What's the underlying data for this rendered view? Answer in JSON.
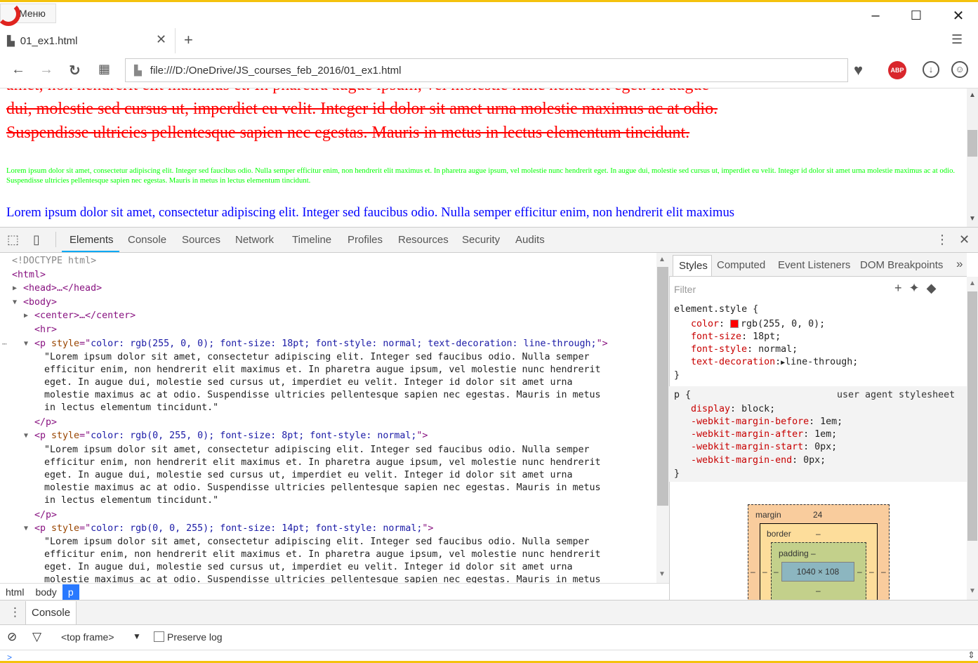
{
  "browser": {
    "menu_label": "Меню",
    "tab_title": "01_ex1.html",
    "address": "file:///D:/OneDrive/JS_courses_feb_2016/01_ex1.html",
    "adblock_label": "ABP"
  },
  "page": {
    "red_text_top": "amet, non hendrerit elit maximus et. In pharetra augue ipsum, vel molestie nunc hendrerit eget. In augue",
    "red_text_lines": [
      "dui, molestie sed cursus ut, imperdiet eu velit. Integer id dolor sit amet urna molestie maximus ac at odio.",
      "Suspendisse ultricies pellentesque sapien nec egestas. Mauris in metus in lectus elementum tincidunt."
    ],
    "green_text": "Lorem ipsum dolor sit amet, consectetur adipiscing elit. Integer sed faucibus odio. Nulla semper efficitur enim, non hendrerit elit maximus et. In pharetra augue ipsum, vel molestie nunc hendrerit eget. In augue dui, molestie sed cursus ut, imperdiet eu velit. Integer id dolor sit amet urna molestie maximus ac at odio. Suspendisse ultricies pellentesque sapien nec egestas. Mauris in metus in lectus elementum tincidunt.",
    "blue_text": "Lorem ipsum dolor sit amet, consectetur adipiscing elit. Integer sed faucibus odio. Nulla semper efficitur enim, non hendrerit elit maximus"
  },
  "devtools": {
    "tabs": [
      "Elements",
      "Console",
      "Sources",
      "Network",
      "Timeline",
      "Profiles",
      "Resources",
      "Security",
      "Audits"
    ],
    "dom": {
      "doctype": "<!DOCTYPE html>",
      "html_open": "<html>",
      "head": "<head>…</head>",
      "body_open": "<body>",
      "center": "<center>…</center>",
      "hr": "<hr>",
      "p1_style": "color: rgb(255, 0, 0); font-size: 18pt; font-style: normal; text-decoration: line-through;",
      "p2_style": "color: rgb(0, 255, 0); font-size: 8pt; font-style: normal;",
      "p3_style": "color: rgb(0, 0, 255); font-size: 14pt; font-style: normal;",
      "text_lines": [
        "\"Lorem ipsum dolor sit amet, consectetur adipiscing elit. Integer sed faucibus odio. Nulla semper",
        "efficitur enim, non hendrerit elit maximus et. In pharetra augue ipsum, vel molestie nunc hendrerit",
        "eget. In augue dui, molestie sed cursus ut, imperdiet eu velit. Integer id dolor sit amet urna",
        "molestie maximus ac at odio. Suspendisse ultricies pellentesque sapien nec egestas. Mauris in metus",
        "in lectus elementum tincidunt.\""
      ],
      "p_close": "</p>"
    },
    "breadcrumbs": [
      "html",
      "body",
      "p"
    ],
    "styles": {
      "tabs": [
        "Styles",
        "Computed",
        "Event Listeners",
        "DOM Breakpoints"
      ],
      "more": "»",
      "filter_placeholder": "Filter",
      "element_style": "element.style {",
      "decls": [
        {
          "prop": "color",
          "val": "rgb(255, 0, 0);"
        },
        {
          "prop": "font-size",
          "val": "18pt;"
        },
        {
          "prop": "font-style",
          "val": "normal;"
        },
        {
          "prop": "text-decoration",
          "val": "line-through;"
        }
      ],
      "close": "}",
      "ua_selector": "p {",
      "ua_label": "user agent stylesheet",
      "ua_decls": [
        {
          "prop": "display",
          "val": "block;"
        },
        {
          "prop": "-webkit-margin-before",
          "val": "1em;"
        },
        {
          "prop": "-webkit-margin-after",
          "val": "1em;"
        },
        {
          "prop": "-webkit-margin-start",
          "val": "0px;"
        },
        {
          "prop": "-webkit-margin-end",
          "val": "0px;"
        }
      ]
    },
    "box_model": {
      "margin_label": "margin",
      "margin_value": "24",
      "border_label": "border",
      "border_value": "–",
      "padding_label": "padding –",
      "content": "1040 × 108",
      "dash": "–"
    },
    "console": {
      "tab": "Console",
      "frame": "<top frame>",
      "preserve_log": "Preserve log",
      "prompt": ">"
    }
  },
  "colors": {
    "accent": "#03a9f4",
    "selected_crumb": "#2979ff",
    "frame": "#f4c20d"
  }
}
